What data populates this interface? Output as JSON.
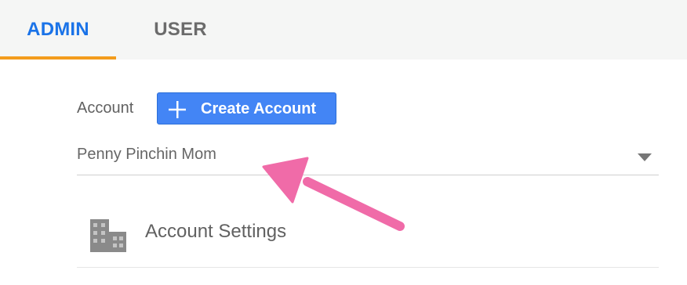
{
  "tabs": {
    "admin": "ADMIN",
    "user": "USER",
    "active": "admin"
  },
  "account": {
    "label": "Account",
    "create_button": "Create Account",
    "selected": "Penny Pinchin Mom"
  },
  "menu": {
    "account_settings": "Account Settings"
  },
  "icons": {
    "plus": "plus-icon",
    "caret": "caret-down-icon",
    "building": "building-icon",
    "annotation": "arrow-annotation"
  },
  "colors": {
    "active_tab": "#1a73e8",
    "tab_indicator": "#f39c1c",
    "button": "#4385f5",
    "annotation_arrow": "#f06ba8"
  }
}
